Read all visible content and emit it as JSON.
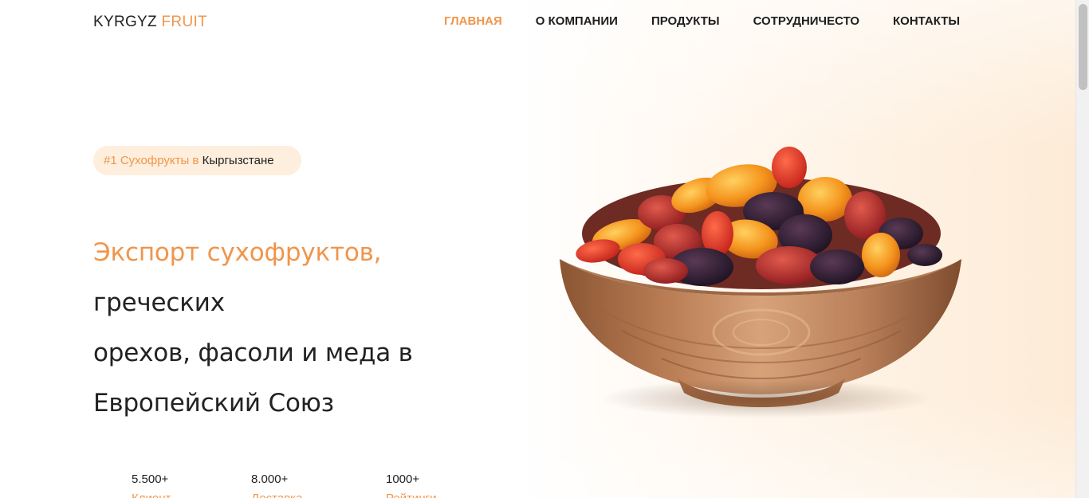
{
  "header": {
    "logo_main": "KYRGYZ",
    "logo_accent": "FRUIT",
    "nav": [
      {
        "label": "ГЛАВНАЯ",
        "active": true
      },
      {
        "label": "О КОМПАНИИ",
        "active": false
      },
      {
        "label": "ПРОДУКТЫ",
        "active": false
      },
      {
        "label": "СОТРУДНИЧЕСТО",
        "active": false
      },
      {
        "label": "КОНТАКТЫ",
        "active": false
      }
    ]
  },
  "badge": {
    "accent_text": "#1 Сухофрукты в",
    "text": "Кыргызстане"
  },
  "hero": {
    "accent_text": "Экспорт сухофруктов,",
    "line1_rest": "греческих",
    "line2": "орехов, фасоли и меда в",
    "line3": "Европейский Союз"
  },
  "stats": [
    {
      "value": "5.500+",
      "label": "Клиент"
    },
    {
      "value": "8.000+",
      "label": "Доставка"
    },
    {
      "value": "1000+",
      "label": "Рейтинги"
    }
  ],
  "image": {
    "icon": "dried-fruit-bowl-image"
  },
  "colors": {
    "accent": "#f0954b",
    "text": "#222222",
    "badge_bg": "#fdeedd"
  }
}
